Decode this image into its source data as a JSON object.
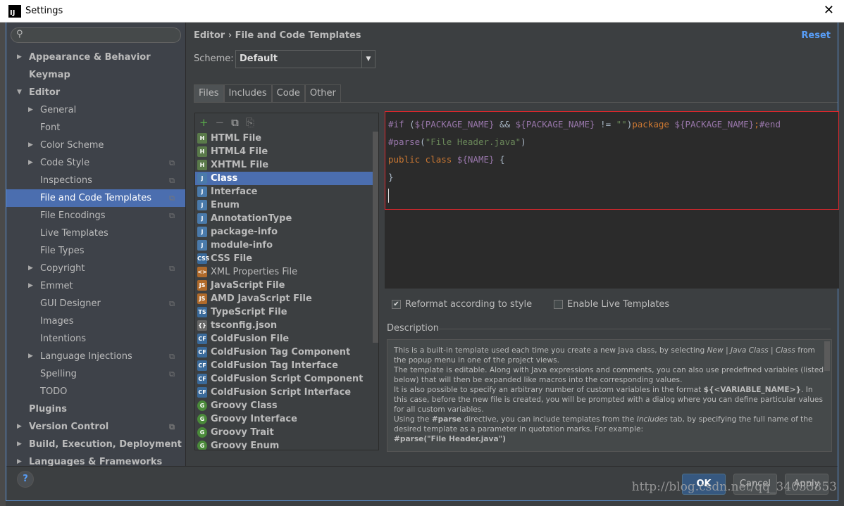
{
  "window": {
    "title": "Settings",
    "close": "✕"
  },
  "sidebar": {
    "search_placeholder": "",
    "items": [
      {
        "label": "Appearance & Behavior",
        "level": 0,
        "arrow": true,
        "bold": true
      },
      {
        "label": "Keymap",
        "level": 0,
        "bold": true
      },
      {
        "label": "Editor",
        "level": 0,
        "arrow": true,
        "open": true,
        "bold": true
      },
      {
        "label": "General",
        "level": 1,
        "arrow": true
      },
      {
        "label": "Font",
        "level": 1
      },
      {
        "label": "Color Scheme",
        "level": 1,
        "arrow": true
      },
      {
        "label": "Code Style",
        "level": 1,
        "arrow": true,
        "copy": true
      },
      {
        "label": "Inspections",
        "level": 1,
        "copy": true
      },
      {
        "label": "File and Code Templates",
        "level": 1,
        "copy": true,
        "selected": true
      },
      {
        "label": "File Encodings",
        "level": 1,
        "copy": true
      },
      {
        "label": "Live Templates",
        "level": 1
      },
      {
        "label": "File Types",
        "level": 1
      },
      {
        "label": "Copyright",
        "level": 1,
        "arrow": true,
        "copy": true
      },
      {
        "label": "Emmet",
        "level": 1,
        "arrow": true
      },
      {
        "label": "GUI Designer",
        "level": 1,
        "copy": true
      },
      {
        "label": "Images",
        "level": 1
      },
      {
        "label": "Intentions",
        "level": 1
      },
      {
        "label": "Language Injections",
        "level": 1,
        "arrow": true,
        "copy": true
      },
      {
        "label": "Spelling",
        "level": 1,
        "copy": true
      },
      {
        "label": "TODO",
        "level": 1
      },
      {
        "label": "Plugins",
        "level": 0,
        "bold": true
      },
      {
        "label": "Version Control",
        "level": 0,
        "arrow": true,
        "copy": true,
        "bold": true
      },
      {
        "label": "Build, Execution, Deployment",
        "level": 0,
        "arrow": true,
        "bold": true
      },
      {
        "label": "Languages & Frameworks",
        "level": 0,
        "arrow": true,
        "bold": true
      }
    ]
  },
  "header": {
    "breadcrumb": "Editor › File and Code Templates",
    "reset": "Reset"
  },
  "scheme": {
    "label": "Scheme:",
    "value": "Default"
  },
  "tabs": [
    {
      "label": "Files",
      "active": true
    },
    {
      "label": "Includes"
    },
    {
      "label": "Code"
    },
    {
      "label": "Other"
    }
  ],
  "toolbar": {
    "add": "+",
    "remove": "−",
    "copy": "⧉",
    "reset": "⎘"
  },
  "files": [
    {
      "label": "HTML File",
      "icon": "H",
      "color": "#5a7a4a"
    },
    {
      "label": "HTML4 File",
      "icon": "H",
      "color": "#5a7a4a"
    },
    {
      "label": "XHTML File",
      "icon": "H",
      "color": "#5a7a4a"
    },
    {
      "label": "Class",
      "icon": "J",
      "color": "#4a7aaa",
      "selected": true
    },
    {
      "label": "Interface",
      "icon": "J",
      "color": "#4a7aaa"
    },
    {
      "label": "Enum",
      "icon": "J",
      "color": "#4a7aaa"
    },
    {
      "label": "AnnotationType",
      "icon": "J",
      "color": "#4a7aaa"
    },
    {
      "label": "package-info",
      "icon": "J",
      "color": "#4a7aaa"
    },
    {
      "label": "module-info",
      "icon": "J",
      "color": "#4a7aaa"
    },
    {
      "label": "CSS File",
      "icon": "CSS",
      "color": "#3a6a9a"
    },
    {
      "label": "XML Properties File",
      "icon": "<>",
      "color": "#b06a2a",
      "light": true
    },
    {
      "label": "JavaScript File",
      "icon": "JS",
      "color": "#b06a2a"
    },
    {
      "label": "AMD JavaScript File",
      "icon": "JS",
      "color": "#b06a2a"
    },
    {
      "label": "TypeScript File",
      "icon": "TS",
      "color": "#3a6a9a"
    },
    {
      "label": "tsconfig.json",
      "icon": "{}",
      "color": "#666"
    },
    {
      "label": "ColdFusion File",
      "icon": "CF",
      "color": "#3a6a9a"
    },
    {
      "label": "ColdFusion Tag Component",
      "icon": "CF",
      "color": "#3a6a9a"
    },
    {
      "label": "ColdFusion Tag Interface",
      "icon": "CF",
      "color": "#3a6a9a"
    },
    {
      "label": "ColdFusion Script Component",
      "icon": "CF",
      "color": "#3a6a9a"
    },
    {
      "label": "ColdFusion Script Interface",
      "icon": "CF",
      "color": "#3a6a9a"
    },
    {
      "label": "Groovy Class",
      "icon": "G",
      "color": "#4a8a3a"
    },
    {
      "label": "Groovy Interface",
      "icon": "G",
      "color": "#4a8a3a"
    },
    {
      "label": "Groovy Trait",
      "icon": "G",
      "color": "#4a8a3a"
    },
    {
      "label": "Groovy Enum",
      "icon": "G",
      "color": "#4a8a3a"
    }
  ],
  "code": {
    "lines": [
      [
        [
          "dir",
          "#if "
        ],
        [
          "mac",
          "("
        ],
        [
          "var",
          "${PACKAGE_NAME}"
        ],
        [
          "mac",
          " && "
        ],
        [
          "var",
          "${PACKAGE_NAME}"
        ],
        [
          "mac",
          " != "
        ],
        [
          "str",
          "\"\""
        ],
        [
          "mac",
          ")"
        ],
        [
          "kw",
          "package "
        ],
        [
          "var",
          "${PACKAGE_NAME}"
        ],
        [
          "kw",
          ";"
        ],
        [
          "dir",
          "#end"
        ]
      ],
      [
        [
          "dir",
          "#parse"
        ],
        [
          "mac",
          "("
        ],
        [
          "str",
          "\"File Header.java\""
        ],
        [
          "mac",
          ")"
        ]
      ],
      [
        [
          "kw",
          "public class "
        ],
        [
          "var",
          "${NAME}"
        ],
        [
          "mac",
          " {"
        ]
      ],
      [
        [
          "mac",
          "}"
        ]
      ]
    ]
  },
  "options": {
    "reformat": {
      "label": "Reformat according to style",
      "checked": true
    },
    "live": {
      "label": "Enable Live Templates",
      "checked": false
    }
  },
  "description": {
    "label": "Description",
    "html": "This is a built-in template used each time you create a new Java class, by selecting <i>New</i> | <i>Java Class</i> | <i>Class</i> from the popup menu in one of the project views.<br>The template is editable. Along with Java expressions and comments, you can also use predefined variables (listed below) that will then be expanded like macros into the corresponding values.<br>It is also possible to specify an arbitrary number of custom variables in the format <b>${&lt;VARIABLE_NAME&gt;}</b>. In this case, before the new file is created, you will be prompted with a dialog where you can define particular values for all custom variables.<br>Using the <b>#parse</b> directive, you can include templates from the <i>Includes</i> tab, by specifying the full name of the desired template as a parameter in quotation marks. For example:<br><b>#parse(\"File Header.java\")</b>"
  },
  "buttons": {
    "help": "?",
    "ok": "OK",
    "cancel": "Cancel",
    "apply": "Apply"
  },
  "watermark": "http://blog.csdn.net/qq_34033853",
  "colors": {
    "selection": "#4b6eaf",
    "editor_bg": "#2b2b2b",
    "highlight_border": "#e0262c",
    "link": "#589df6"
  }
}
